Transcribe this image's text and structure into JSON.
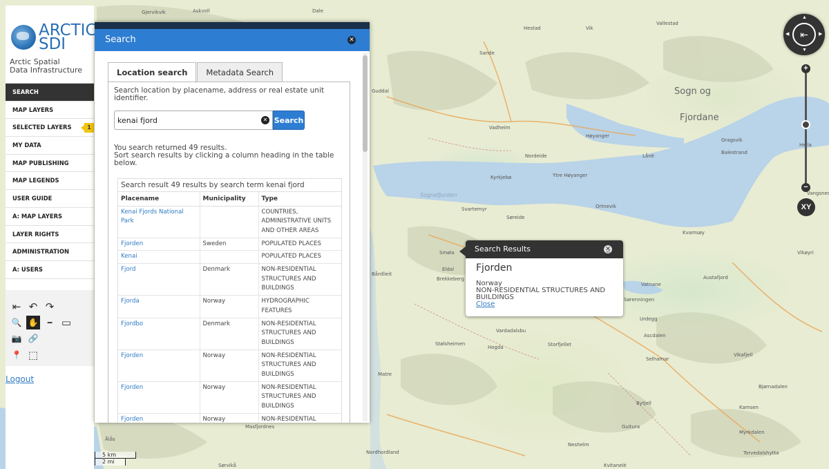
{
  "sidebar": {
    "logo_title": "ARCTIC SDI",
    "logo_title_lines": [
      "ARCTIC",
      "SDI"
    ],
    "logo_subtitle_lines": [
      "Arctic Spatial",
      "Data Infrastructure"
    ],
    "menu": [
      {
        "label": "SEARCH",
        "active": true
      },
      {
        "label": "MAP LAYERS"
      },
      {
        "label": "SELECTED LAYERS",
        "badge": "1"
      },
      {
        "label": "MY DATA"
      },
      {
        "label": "MAP PUBLISHING"
      },
      {
        "label": "MAP LEGENDS"
      },
      {
        "label": "USER GUIDE"
      },
      {
        "label": "A: MAP LAYERS"
      },
      {
        "label": "LAYER RIGHTS"
      },
      {
        "label": "ADMINISTRATION"
      },
      {
        "label": "A: USERS"
      }
    ],
    "tools": [
      {
        "name": "history-back-icon",
        "glyph": "⇤"
      },
      {
        "name": "undo-icon",
        "glyph": "↶"
      },
      {
        "name": "redo-icon",
        "glyph": "↷"
      },
      {
        "name": "zoom-box-icon",
        "glyph": "🔍"
      },
      {
        "name": "pan-hand-icon",
        "glyph": "✋",
        "selected": true
      },
      {
        "name": "measure-line-icon",
        "glyph": "━"
      },
      {
        "name": "measure-area-icon",
        "glyph": "▭"
      },
      {
        "name": "camera-icon",
        "glyph": "📷"
      },
      {
        "name": "link-icon",
        "glyph": "🔗"
      },
      {
        "name": "pin-icon",
        "glyph": "📍"
      },
      {
        "name": "select-area-icon",
        "glyph": "⬚"
      }
    ],
    "logout": "Logout"
  },
  "search": {
    "header_title": "Search",
    "tabs": [
      "Location search",
      "Metadata Search"
    ],
    "active_tab": 0,
    "description": "Search location by placename, address or real estate unit identifier.",
    "input_value": "kenai fjord",
    "button_label": "Search",
    "result_lines": [
      "You search returned 49 results.",
      "Sort search results by clicking a column heading in the table below."
    ],
    "table_caption": "Search result 49 results by search term kenai fjord",
    "columns": [
      "Placename",
      "Municipality",
      "Type"
    ],
    "rows": [
      {
        "place": "Kenai Fjords National Park",
        "municipality": "",
        "type": "COUNTRIES, ADMINISTRATIVE UNITS AND OTHER AREAS"
      },
      {
        "place": "Fjorden",
        "municipality": "Sweden",
        "type": "POPULATED PLACES"
      },
      {
        "place": "Kenai",
        "municipality": "",
        "type": "POPULATED PLACES"
      },
      {
        "place": "Fjord",
        "municipality": "Denmark",
        "type": "NON-RESIDENTIAL STRUCTURES AND BUILDINGS"
      },
      {
        "place": "Fjorda",
        "municipality": "Norway",
        "type": "HYDROGRAPHIC FEATURES"
      },
      {
        "place": "Fjordbo",
        "municipality": "Denmark",
        "type": "NON-RESIDENTIAL STRUCTURES AND BUILDINGS"
      },
      {
        "place": "Fjorden",
        "municipality": "Norway",
        "type": "NON-RESIDENTIAL STRUCTURES AND BUILDINGS"
      },
      {
        "place": "Fjorden",
        "municipality": "Norway",
        "type": "NON-RESIDENTIAL STRUCTURES AND BUILDINGS"
      },
      {
        "place": "Fjorden",
        "municipality": "Norway",
        "type": "NON-RESIDENTIAL STRUCTURES AND BUILDINGS"
      }
    ]
  },
  "popup": {
    "header": "Search Results",
    "title": "Fjorden",
    "country": "Norway",
    "type": "NON-RESIDENTIAL STRUCTURES AND BUILDINGS",
    "close_link": "Close"
  },
  "map_controls": {
    "xy_label": "XY",
    "scale_km": "5 km",
    "scale_mi": "2 mi"
  },
  "map_labels": [
    "Gjervikvik",
    "Askvoll",
    "Dale",
    "Vallestad",
    "Hestad",
    "Vik",
    "Sande",
    "Guddal",
    "Sogn og",
    "Fjordane",
    "Vadheim",
    "Høyanger",
    "Gragsvik",
    "Hella",
    "Balestrand",
    "Nordeide",
    "Lånè",
    "Kyrkjebø",
    "Ytre Høyanger",
    "Sognefjorden",
    "Ortnevik",
    "Svartemyr",
    "Søreide",
    "Kvamsøy",
    "Vangsnes",
    "Vikøyri",
    "Smøla",
    "Eldal",
    "Brekkeberg",
    "Bårdlieit",
    "Vatnane",
    "Austafjord",
    "Sørenningen",
    "Urdegg",
    "Vardadalsbu",
    "Ascdalen",
    "Stølsheimen",
    "Hogda",
    "Storfjellet",
    "Selhamar",
    "Vikafjell",
    "Bjørnadalen",
    "Bytjell",
    "Kamsen",
    "Matre",
    "Masfjordnes",
    "Guitura",
    "Myrkdalen",
    "Nordhordland",
    "Ålås",
    "Neshelm",
    "Torvedalshytta",
    "Kvitanelé",
    "Sørvikå"
  ]
}
